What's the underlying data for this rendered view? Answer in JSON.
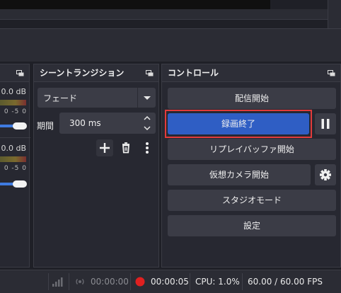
{
  "docks": {
    "audio": {
      "db_top": "0.0 dB",
      "ticks_top": "0 -5 0",
      "db_bottom": "0.0 dB",
      "ticks_bottom": "0 -5 0"
    },
    "transitions": {
      "title": "シーントランジション",
      "transition_value": "フェード",
      "duration_label": "期間",
      "duration_value": "300 ms"
    },
    "controls": {
      "title": "コントロール",
      "start_streaming": "配信開始",
      "stop_recording": "録画終了",
      "start_replay_buffer": "リプレイバッファ開始",
      "start_virtual_camera": "仮想カメラ開始",
      "studio_mode": "スタジオモード",
      "settings": "設定"
    }
  },
  "status": {
    "stream_time": "00:00:00",
    "record_time": "00:00:05",
    "cpu": "CPU: 1.0%",
    "fps": "60.00 / 60.00 FPS"
  },
  "colors": {
    "accent": "#2f5ec4",
    "highlight": "#e33b3b",
    "record_dot": "#e02020"
  }
}
